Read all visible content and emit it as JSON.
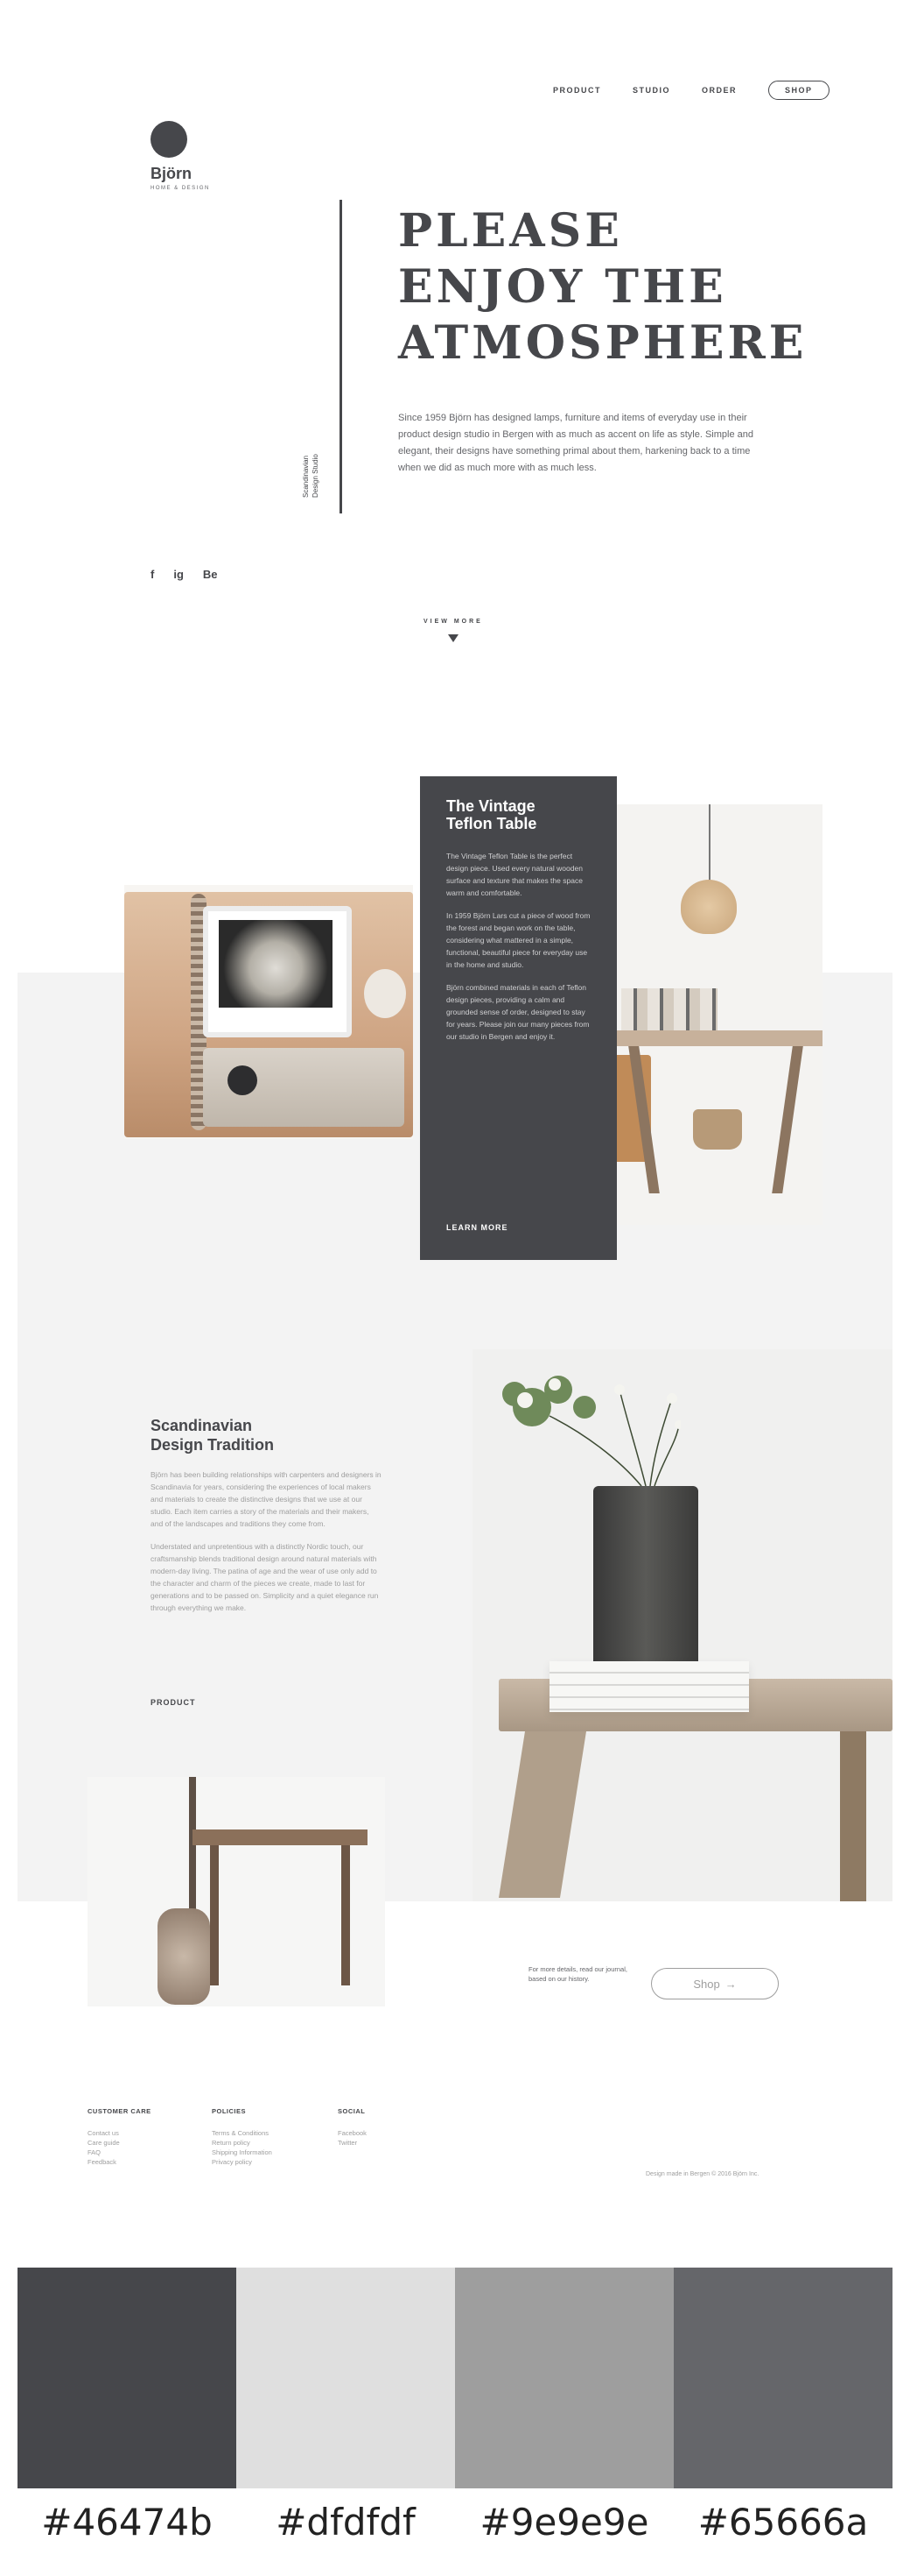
{
  "nav": {
    "items": [
      "PRODUCT",
      "STUDIO",
      "ORDER"
    ],
    "shop_label": "SHOP"
  },
  "brand": {
    "name": "Björn",
    "tagline": "HOME & DESIGN"
  },
  "hero": {
    "title_lines": [
      "PLEASE",
      "ENJOY THE",
      "ATMOSPHERE"
    ],
    "text": "Since 1959 Björn has designed lamps, furniture and items of everyday use in their product design studio in Bergen with as much as accent on life as style. Simple and elegant, their designs have something primal about them, harkening back to a time when we did as much more with as much less.",
    "vertical_text": "Scandinavian\nDesign Studio",
    "view_more": "VIEW MORE"
  },
  "social": {
    "facebook": "f",
    "instagram": "ig",
    "behance": "Be"
  },
  "product_card": {
    "title": "The Vintage Teflon Table",
    "paragraphs": [
      "The Vintage Teflon Table is the perfect design piece. Used every natural wooden surface and texture that makes the space warm and comfortable.",
      "In 1959 Björn Lars cut a piece of wood from the forest and began work on the table, considering what mattered in a simple, functional, beautiful piece for everyday use in the home and studio.",
      "Björn combined materials in each of Teflon design pieces, providing a calm and grounded sense of order, designed to stay for years. Please join our many pieces from our studio in Bergen and enjoy it."
    ],
    "link": "LEARN MORE"
  },
  "scandinavian": {
    "title_line1": "Scandinavian",
    "title_line2": "Design Tradition",
    "paragraphs": [
      "Björn has been building relationships with carpenters and designers in Scandinavia for years, considering the experiences of local makers and materials to create the distinctive designs that we use at our studio. Each item carries a story of the materials and their makers, and of the landscapes and traditions they come from.",
      "Understated and unpretentious with a distinctly Nordic touch, our craftsmanship blends traditional design around natural materials with modern-day living. The patina of age and the wear of use only add to the character and charm of the pieces we create, made to last for generations and to be passed on. Simplicity and a quiet elegance run through everything we make."
    ],
    "link": "PRODUCT"
  },
  "cta": {
    "text": "For more details, read our journal, based on our history.",
    "button_label": "Shop"
  },
  "footer": {
    "columns": [
      {
        "heading": "CUSTOMER CARE",
        "items": [
          "Contact us",
          "Care guide",
          "FAQ",
          "Feedback"
        ]
      },
      {
        "heading": "POLICIES",
        "items": [
          "Terms & Conditions",
          "Return policy",
          "Shipping Information",
          "Privacy policy"
        ]
      },
      {
        "heading": "SOCIAL",
        "items": [
          "Facebook",
          "Twitter"
        ]
      }
    ],
    "copyright": "Design made in Bergen © 2016 Björn Inc."
  },
  "palette": [
    {
      "label": "#46474b",
      "color": "#46474b"
    },
    {
      "label": "#dfdfdf",
      "color": "#dfdfdf"
    },
    {
      "label": "#9e9e9e",
      "color": "#9e9e9e"
    },
    {
      "label": "#65666a",
      "color": "#65666a"
    }
  ]
}
